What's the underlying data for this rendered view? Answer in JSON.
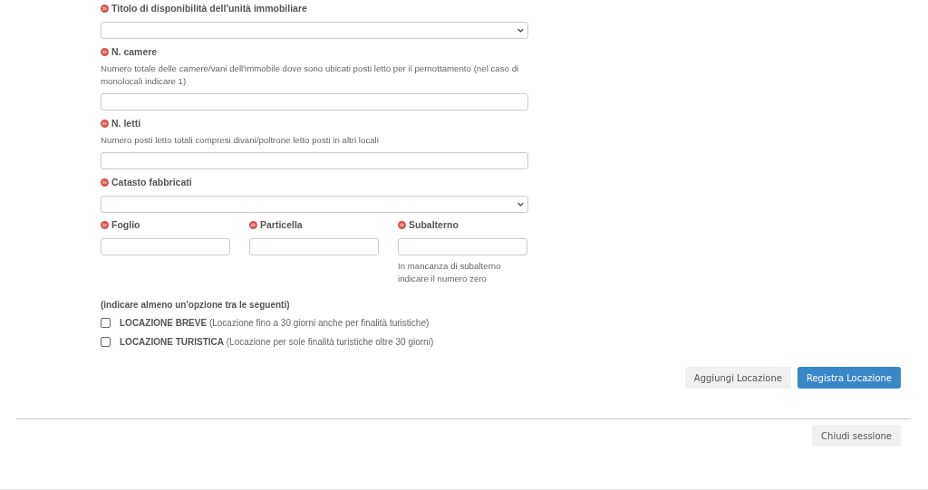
{
  "fields": [
    {
      "label": "Titolo di disponibilità dell'unità immobiliare",
      "required": true,
      "kind": "select"
    },
    {
      "label": "N. camere",
      "required": true,
      "help": "Numero totale delle camere/vani dell'immobile dove sono ubicati posti letto per il pernottamento (nel caso di monolocali indicare 1)",
      "kind": "text"
    },
    {
      "label": "N. letti",
      "required": true,
      "help": "Numero posti letto totali compresi divani/poltrone letto posti in altri locali",
      "kind": "text"
    },
    {
      "label": "Catasto fabbricati",
      "required": true,
      "kind": "select"
    }
  ],
  "cadastral_fields": [
    {
      "label": "Foglio",
      "required": true
    },
    {
      "label": "Particella",
      "required": true
    },
    {
      "label": "Subalterno",
      "required": true,
      "help": "In mancanza di subalterno indicare il numero zero"
    }
  ],
  "options_heading": "(indicare almeno un'opzione tra le seguenti)",
  "options": [
    {
      "label": "**LOCAZIONE BREVE** (Locazione fino a 30 giorni anche per finalità turistiche)",
      "checked": false
    },
    {
      "label": "**LOCAZIONE TURISTICA** (Locazione per sole finalità turistiche oltre 30 giorni)",
      "checked": false
    }
  ],
  "buttons": [
    {
      "label": "Aggiungi Locazione",
      "kind": "secondary"
    },
    {
      "label": "Registra Locazione",
      "kind": "primary"
    }
  ],
  "footer_button": {
    "label": "Chiudi sessione"
  }
}
